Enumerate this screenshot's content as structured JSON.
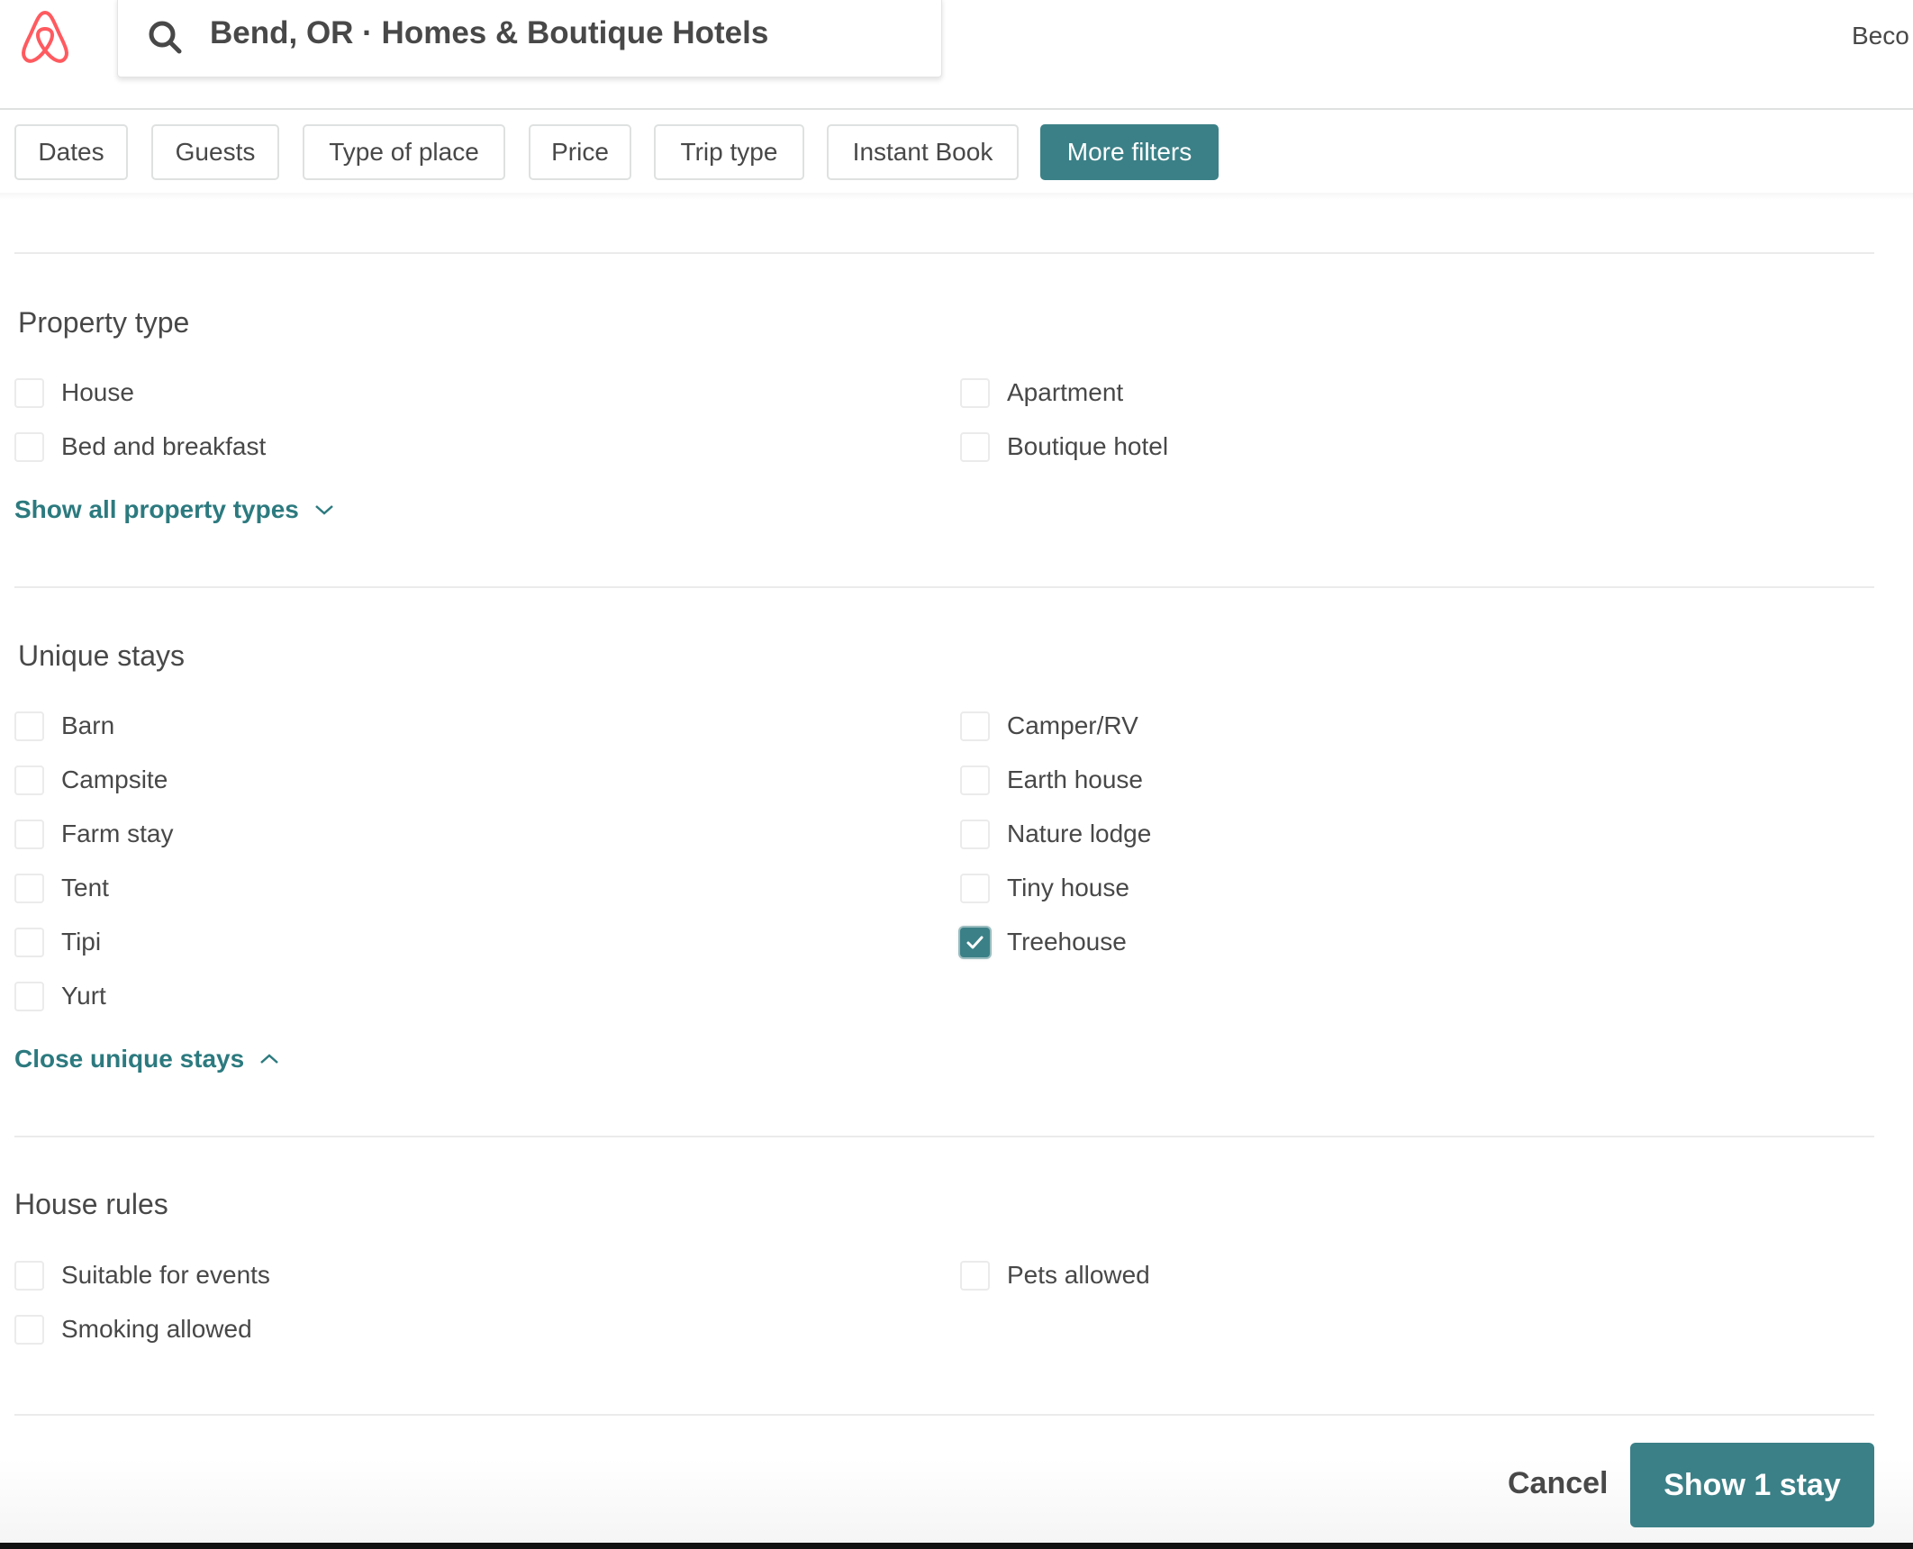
{
  "header": {
    "logo_icon": "airbnb-logo-icon",
    "search_icon": "search-icon",
    "search_text": "Bend, OR · Homes & Boutique Hotels",
    "become_host_partial": "Beco"
  },
  "filters": [
    {
      "label": "Dates",
      "active": false
    },
    {
      "label": "Guests",
      "active": false
    },
    {
      "label": "Type of place",
      "active": false
    },
    {
      "label": "Price",
      "active": false
    },
    {
      "label": "Trip type",
      "active": false
    },
    {
      "label": "Instant Book",
      "active": false
    },
    {
      "label": "More filters",
      "active": true
    }
  ],
  "sections": {
    "property_type": {
      "title": "Property type",
      "items": [
        {
          "label": "House",
          "checked": false
        },
        {
          "label": "Apartment",
          "checked": false
        },
        {
          "label": "Bed and breakfast",
          "checked": false
        },
        {
          "label": "Boutique hotel",
          "checked": false
        }
      ],
      "link": "Show all property types",
      "link_icon": "chevron-down-icon"
    },
    "unique_stays": {
      "title": "Unique stays",
      "items": [
        {
          "label": "Barn",
          "checked": false
        },
        {
          "label": "Camper/RV",
          "checked": false
        },
        {
          "label": "Campsite",
          "checked": false
        },
        {
          "label": "Earth house",
          "checked": false
        },
        {
          "label": "Farm stay",
          "checked": false
        },
        {
          "label": "Nature lodge",
          "checked": false
        },
        {
          "label": "Tent",
          "checked": false
        },
        {
          "label": "Tiny house",
          "checked": false
        },
        {
          "label": "Tipi",
          "checked": false
        },
        {
          "label": "Treehouse",
          "checked": true
        },
        {
          "label": "Yurt",
          "checked": false
        }
      ],
      "link": "Close unique stays",
      "link_icon": "chevron-up-icon"
    },
    "house_rules": {
      "title": "House rules",
      "items": [
        {
          "label": "Suitable for events",
          "checked": false
        },
        {
          "label": "Pets allowed",
          "checked": false
        },
        {
          "label": "Smoking allowed",
          "checked": false
        }
      ]
    }
  },
  "footer": {
    "cancel_label": "Cancel",
    "show_label": "Show 1 stay"
  },
  "colors": {
    "accent": "#3b8087",
    "link": "#2c7a7f",
    "brand": "#ff5a5f",
    "text": "#484848"
  }
}
